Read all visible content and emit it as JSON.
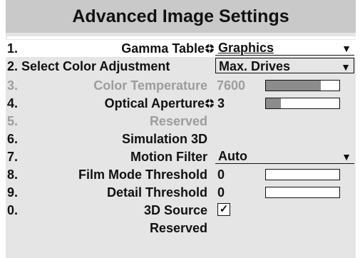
{
  "title": "Advanced Image Settings",
  "rows": [
    {
      "num": "1.",
      "label": "Gamma Table",
      "value": "Graphics"
    },
    {
      "num": "",
      "label": "2. Select Color Adjustment",
      "value": "Max. Drives"
    },
    {
      "num": "3.",
      "label": "Color Temperature",
      "value": "7600",
      "slider": 0.75
    },
    {
      "num": "4.",
      "label": "Optical Aperture",
      "value": "3",
      "slider": 0.2
    },
    {
      "num": "5.",
      "label": "Reserved"
    },
    {
      "num": "6.",
      "label": "Simulation 3D"
    },
    {
      "num": "7.",
      "label": "Motion Filter",
      "value": "Auto"
    },
    {
      "num": "8.",
      "label": "Film Mode Threshold",
      "value": "0",
      "slider": 0
    },
    {
      "num": "9.",
      "label": "Detail Threshold",
      "value": "0",
      "slider": 0
    },
    {
      "num": "0.",
      "label": "3D Source",
      "check": "✓"
    },
    {
      "num": "",
      "label": "Reserved"
    }
  ],
  "dropdown_arrow": "▼"
}
